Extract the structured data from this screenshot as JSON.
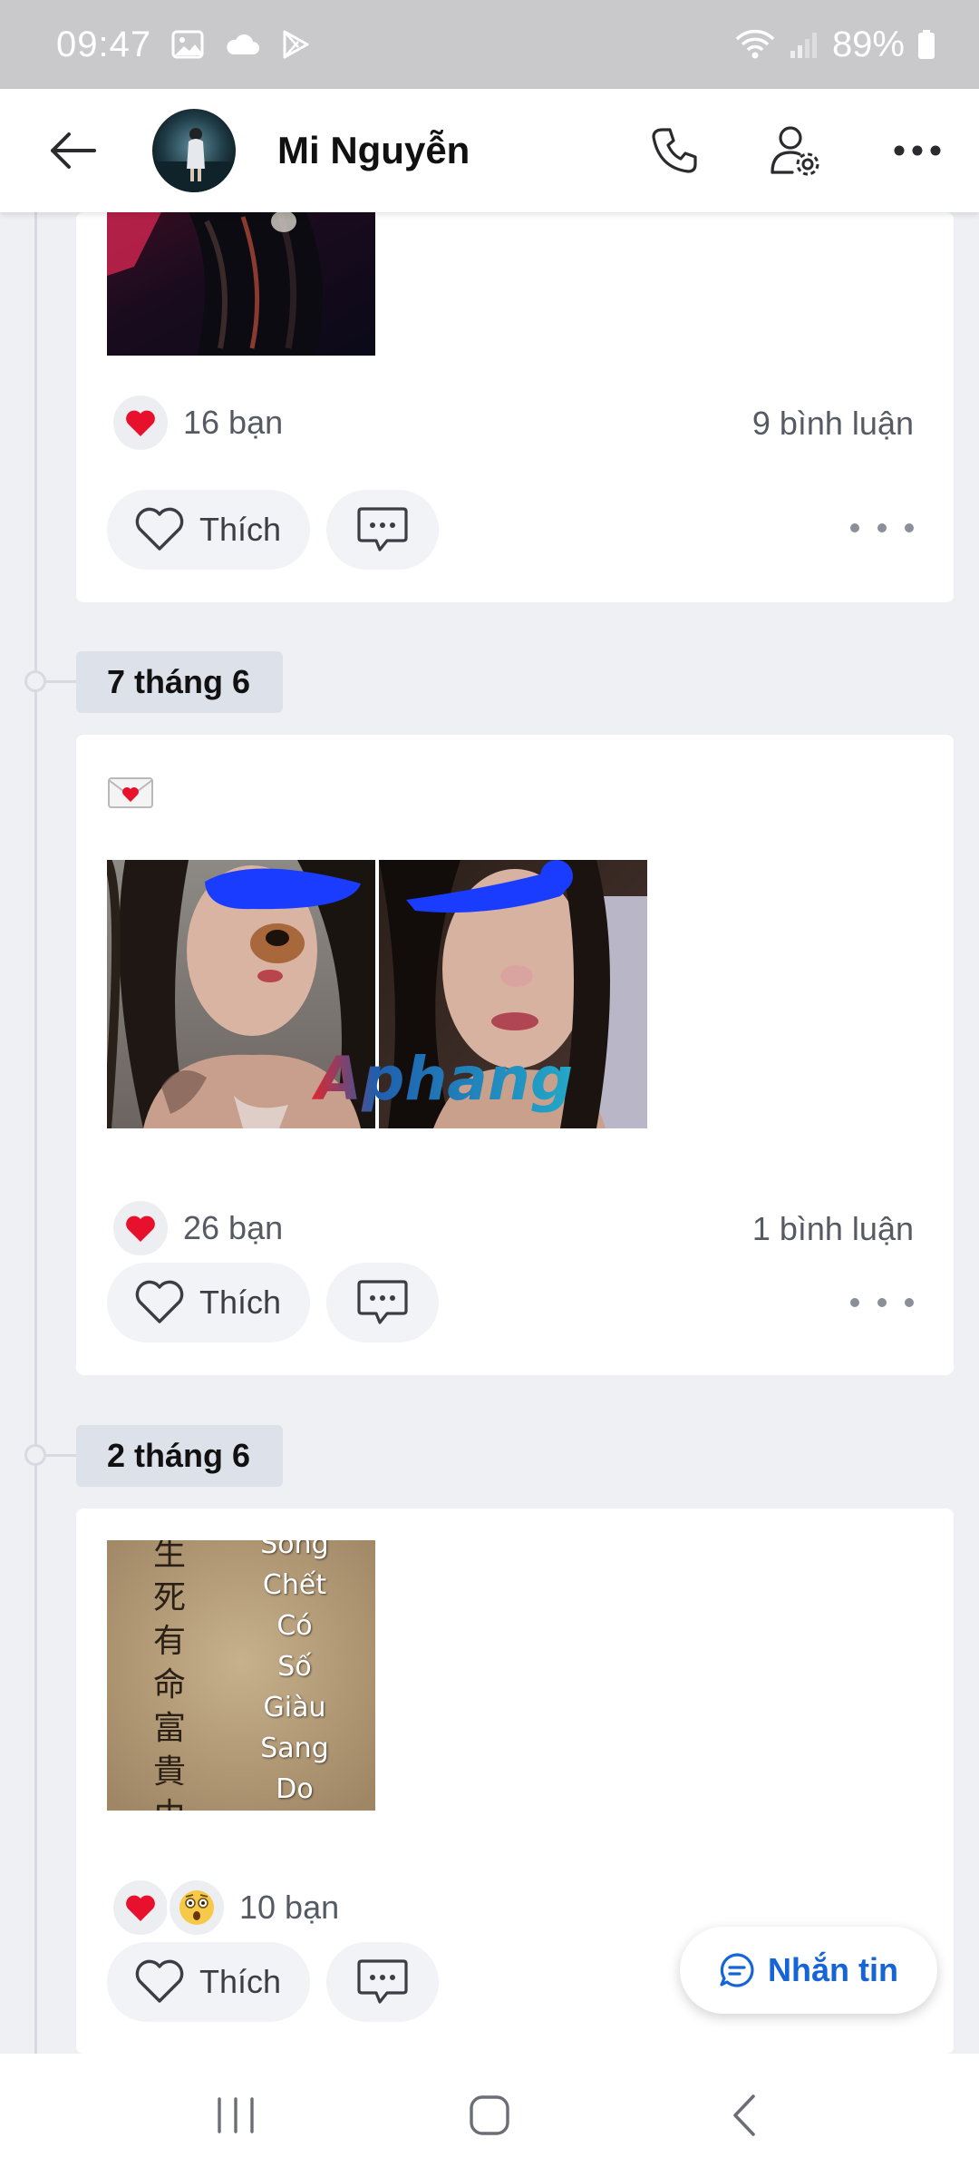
{
  "status_bar": {
    "time": "09:47",
    "battery": "89%"
  },
  "header": {
    "contact_name": "Mi Nguyễn"
  },
  "posts": [
    {
      "reactions": "16 bạn",
      "comments": "9 bình luận",
      "like_label": "Thích"
    },
    {
      "date": "7 tháng 6",
      "watermark": "Aphang",
      "reactions": "26 bạn",
      "comments": "1 bình luận",
      "like_label": "Thích"
    },
    {
      "date": "2 tháng 6",
      "image_text": [
        "Sống",
        "Chết",
        "Có",
        "Số",
        "Giàu",
        "Sang",
        "Do"
      ],
      "reactions": "10 bạn",
      "like_label": "Thích"
    }
  ],
  "message_button": {
    "label": "Nhắn tin"
  },
  "colors": {
    "accent": "#1565d8",
    "heart": "#e8112d",
    "blur_marker": "#1a3cff"
  }
}
